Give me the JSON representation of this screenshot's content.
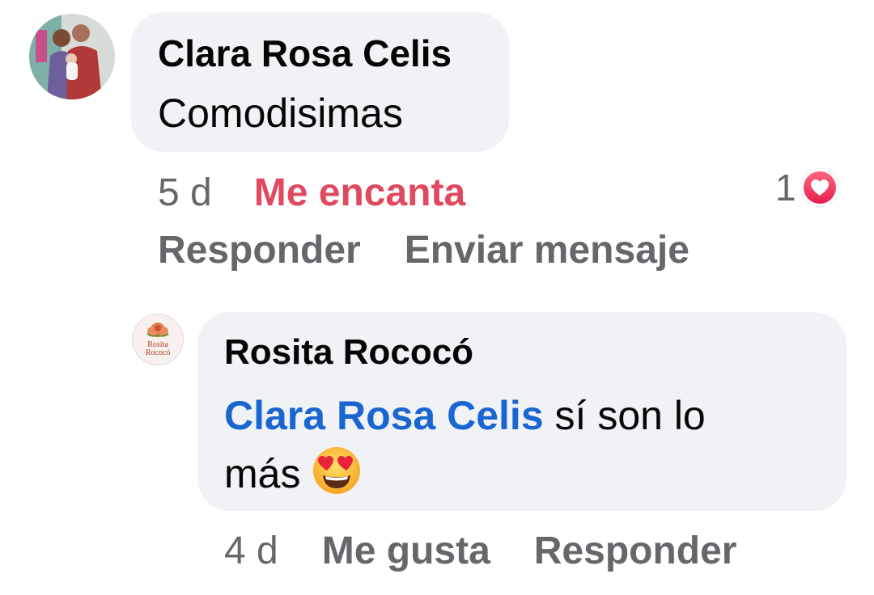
{
  "comment": {
    "author": "Clara Rosa Celis",
    "text": "Comodisimas",
    "time": "5 d",
    "reaction_label": "Me encanta",
    "reaction_count": "1",
    "reaction_icon": "heart-icon",
    "reply_label": "Responder",
    "message_label": "Enviar mensaje"
  },
  "reply": {
    "author": "Rosita Rococó",
    "mention": "Clara Rosa Celis",
    "text_line": " sí son lo",
    "text_tail": "más ",
    "emoji": "heart-eyes-emoji",
    "time": "4 d",
    "like_label": "Me gusta",
    "reply_label": "Responder",
    "avatar_logo": "Rosita Rococó"
  },
  "colors": {
    "bubble": "#f0f2f5",
    "love": "#e0495f",
    "mention": "#1a66d0",
    "meta": "#65676b"
  }
}
